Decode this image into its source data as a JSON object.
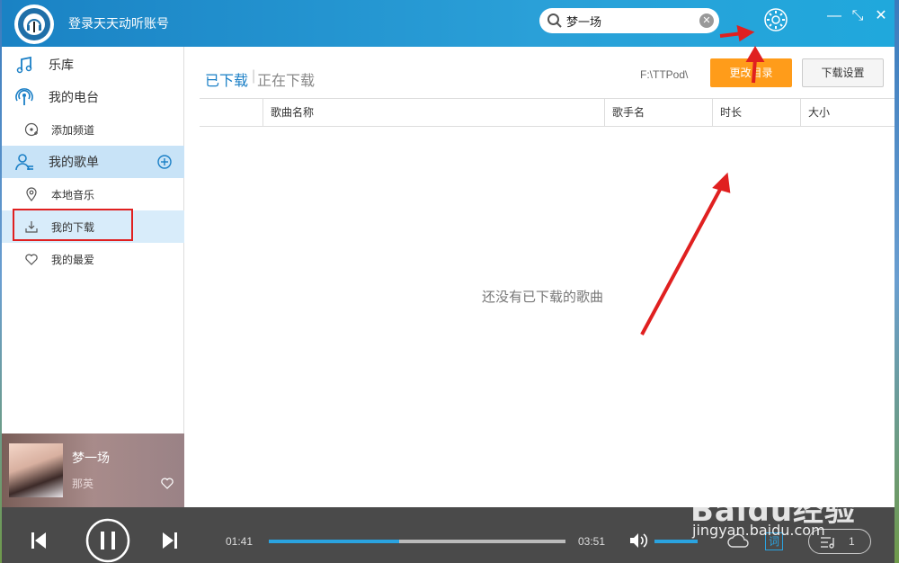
{
  "titlebar": {
    "login_text": "登录天天动听账号",
    "search_value": "梦一场",
    "minimize": "—",
    "restore": "⤡",
    "close": "✕"
  },
  "sidebar": {
    "items": [
      {
        "label": "乐库",
        "icon": "music-note-icon"
      },
      {
        "label": "我的电台",
        "icon": "radio-antenna-icon"
      },
      {
        "label": "添加频道",
        "icon": "add-channel-icon"
      },
      {
        "label": "我的歌单",
        "icon": "user-playlist-icon"
      },
      {
        "label": "本地音乐",
        "icon": "location-pin-icon"
      },
      {
        "label": "我的下载",
        "icon": "download-icon"
      },
      {
        "label": "我的最爱",
        "icon": "heart-icon"
      }
    ]
  },
  "now_playing": {
    "title": "梦一场",
    "artist": "那英"
  },
  "main": {
    "tab_done": "已下载",
    "tab_sep": "|",
    "tab_doing": "正在下载",
    "path": "F:\\TTPod\\",
    "change_dir_button": "更改目录",
    "download_settings_button": "下载设置",
    "columns": [
      "歌曲名称",
      "歌手名",
      "时长",
      "大小"
    ],
    "empty_message": "还没有已下载的歌曲"
  },
  "player": {
    "current_time": "01:41",
    "total_time": "03:51",
    "progress": 0.44,
    "volume": 1.0,
    "lyrics_label": "词",
    "queue_count": "1"
  },
  "watermark": {
    "brand": "Baidu经验",
    "url": "jingyan.baidu.com"
  },
  "colors": {
    "accent": "#1a7fc6",
    "orange": "#ff9c1a",
    "annotation": "#e02020",
    "player_bg": "#4a4a4a"
  }
}
